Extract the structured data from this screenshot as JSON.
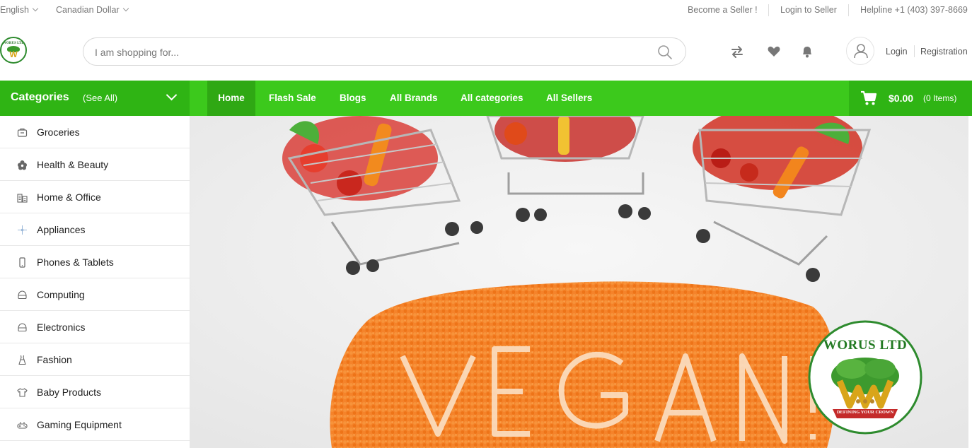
{
  "topbar": {
    "language": "English",
    "currency": "Canadian Dollar",
    "become_seller": "Become a Seller !",
    "login_seller": "Login to Seller",
    "helpline": "Helpline +1 (403) 397-8669"
  },
  "header": {
    "logo_text": "WORUS LTD",
    "search_placeholder": "I am shopping for...",
    "login": "Login",
    "registration": "Registration"
  },
  "nav": {
    "categories_title": "Categories",
    "see_all": "(See All)",
    "items": [
      {
        "label": "Home",
        "active": true
      },
      {
        "label": "Flash Sale"
      },
      {
        "label": "Blogs"
      },
      {
        "label": "All Brands"
      },
      {
        "label": "All categories"
      },
      {
        "label": "All Sellers"
      }
    ],
    "cart_amount": "$0.00",
    "cart_count": "(0 Items)"
  },
  "sidebar": {
    "categories": [
      {
        "label": "Groceries",
        "icon": "groceries-icon"
      },
      {
        "label": "Health & Beauty",
        "icon": "flower-icon"
      },
      {
        "label": "Home & Office",
        "icon": "office-icon"
      },
      {
        "label": "Appliances",
        "icon": "appliance-icon"
      },
      {
        "label": "Phones & Tablets",
        "icon": "phone-icon"
      },
      {
        "label": "Computing",
        "icon": "computer-icon"
      },
      {
        "label": "Electronics",
        "icon": "electronics-icon"
      },
      {
        "label": "Fashion",
        "icon": "dress-icon"
      },
      {
        "label": "Baby Products",
        "icon": "baby-shirt-icon"
      },
      {
        "label": "Gaming Equipment",
        "icon": "gamepad-icon"
      }
    ]
  },
  "hero": {
    "logo_title": "WORUS LTD",
    "logo_ribbon": "DEFINING YOUR CROWN"
  },
  "colors": {
    "brand_green": "#3cc91c",
    "brand_green_dark": "#2fb414",
    "lentil_orange": "#f07a1a"
  }
}
